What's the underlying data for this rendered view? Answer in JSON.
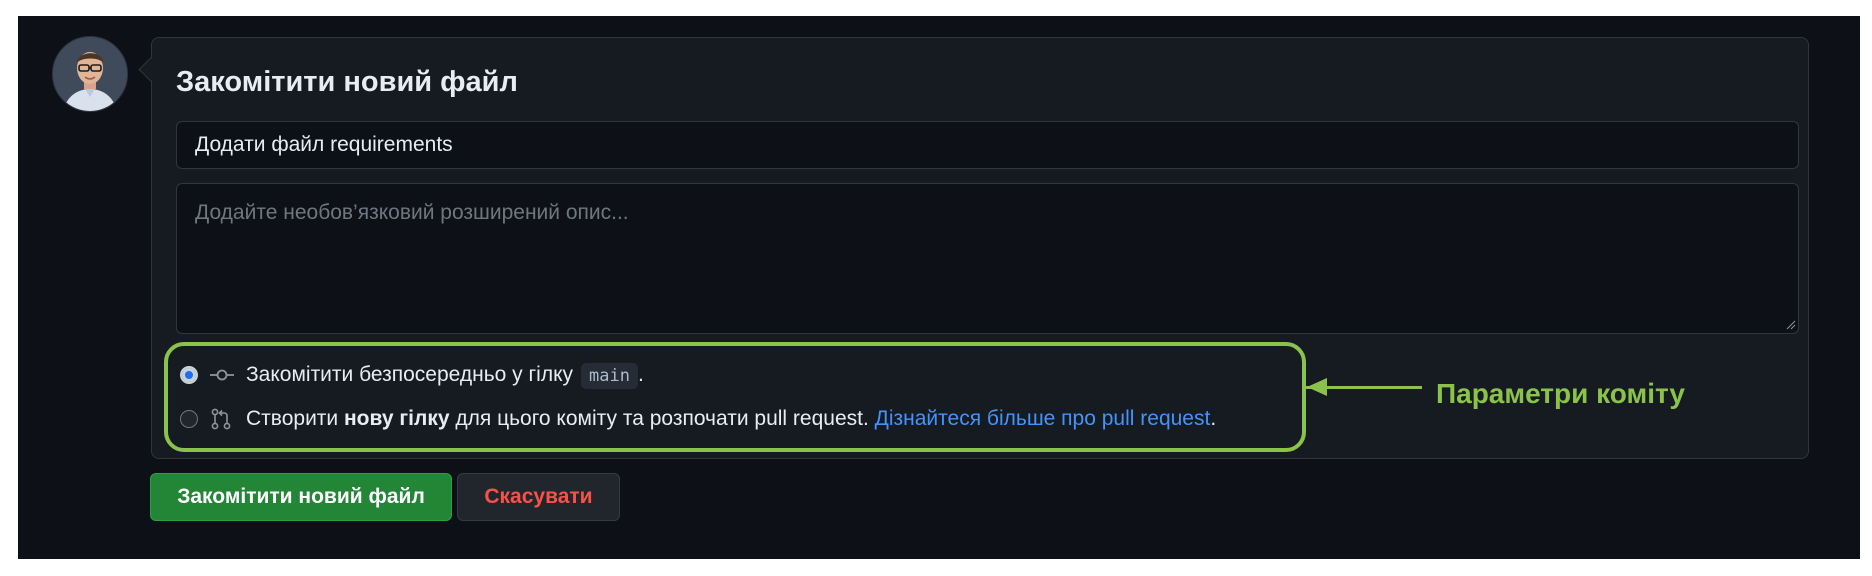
{
  "commit_form": {
    "title": "Закомітити новий файл",
    "summary_value": "Додати файл requirements",
    "description_placeholder": "Додайте необов’язковий розширений опис...",
    "options": {
      "direct": {
        "text": "Закомітити безпосередньо у гілку",
        "branch": "main",
        "end": ".",
        "selected": true
      },
      "new_branch": {
        "prefix": "Створити ",
        "bold": "нову гілку",
        "middle": " для цього коміту та розпочати pull request. ",
        "link": "Дізнайтеся більше про pull request",
        "end": ".",
        "selected": false
      }
    },
    "commit_button": "Закомітити новий файл",
    "cancel_button": "Скасувати"
  },
  "annotation": {
    "label": "Параметри коміту",
    "color": "#8bc34a"
  },
  "colors": {
    "background": "#0d1117",
    "panel": "#161b22",
    "commit_button": "#238636",
    "cancel_text": "#f85149",
    "link": "#4493f8"
  },
  "icons": {
    "direct_option": "git-commit-icon",
    "new_branch_option": "git-pull-request-icon"
  }
}
